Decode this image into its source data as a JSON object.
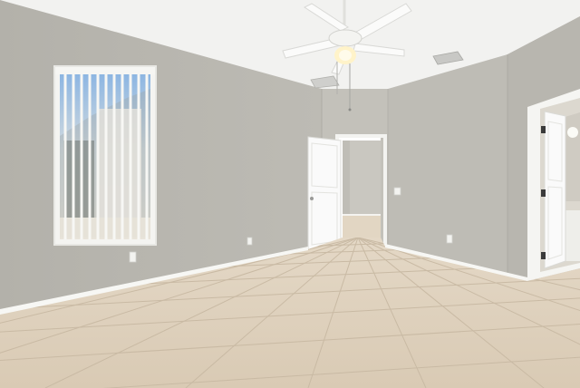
{
  "colors": {
    "ceiling": "#f2f2f0",
    "wall_left": "#b9b7b0",
    "wall_back": "#c3c1ba",
    "wall_right": "#bebcb5",
    "floor": "#ddd0bd",
    "grout": "#c8b9a3",
    "trim": "#f6f6f3",
    "door": "#fafafa",
    "sky": "#6f9fd6",
    "hinge": "#3a3a3a"
  }
}
